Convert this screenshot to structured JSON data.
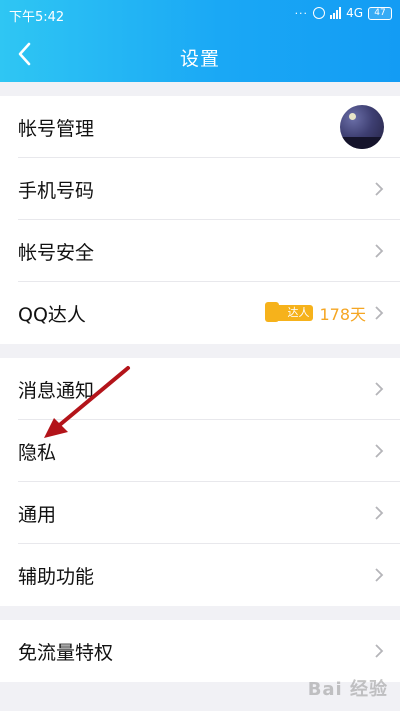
{
  "status_bar": {
    "time": "下午5:42",
    "dots": "···",
    "network": "4G",
    "battery": "47"
  },
  "header": {
    "title": "设置"
  },
  "group1": [
    {
      "label": "帐号管理",
      "trailing": "avatar"
    },
    {
      "label": "手机号码",
      "trailing": "chevron"
    },
    {
      "label": "帐号安全",
      "trailing": "chevron"
    },
    {
      "label": "QQ达人",
      "trailing": "badge",
      "badge_text": "达人",
      "days": "178天"
    }
  ],
  "group2": [
    {
      "label": "消息通知"
    },
    {
      "label": "隐私"
    },
    {
      "label": "通用"
    },
    {
      "label": "辅助功能"
    }
  ],
  "group3": [
    {
      "label": "免流量特权"
    }
  ],
  "watermark": "Bai 经验",
  "colors": {
    "header_start": "#2fc6f3",
    "header_end": "#139cf4",
    "badge": "#f6b21b",
    "annotation_arrow": "#b3141a"
  }
}
